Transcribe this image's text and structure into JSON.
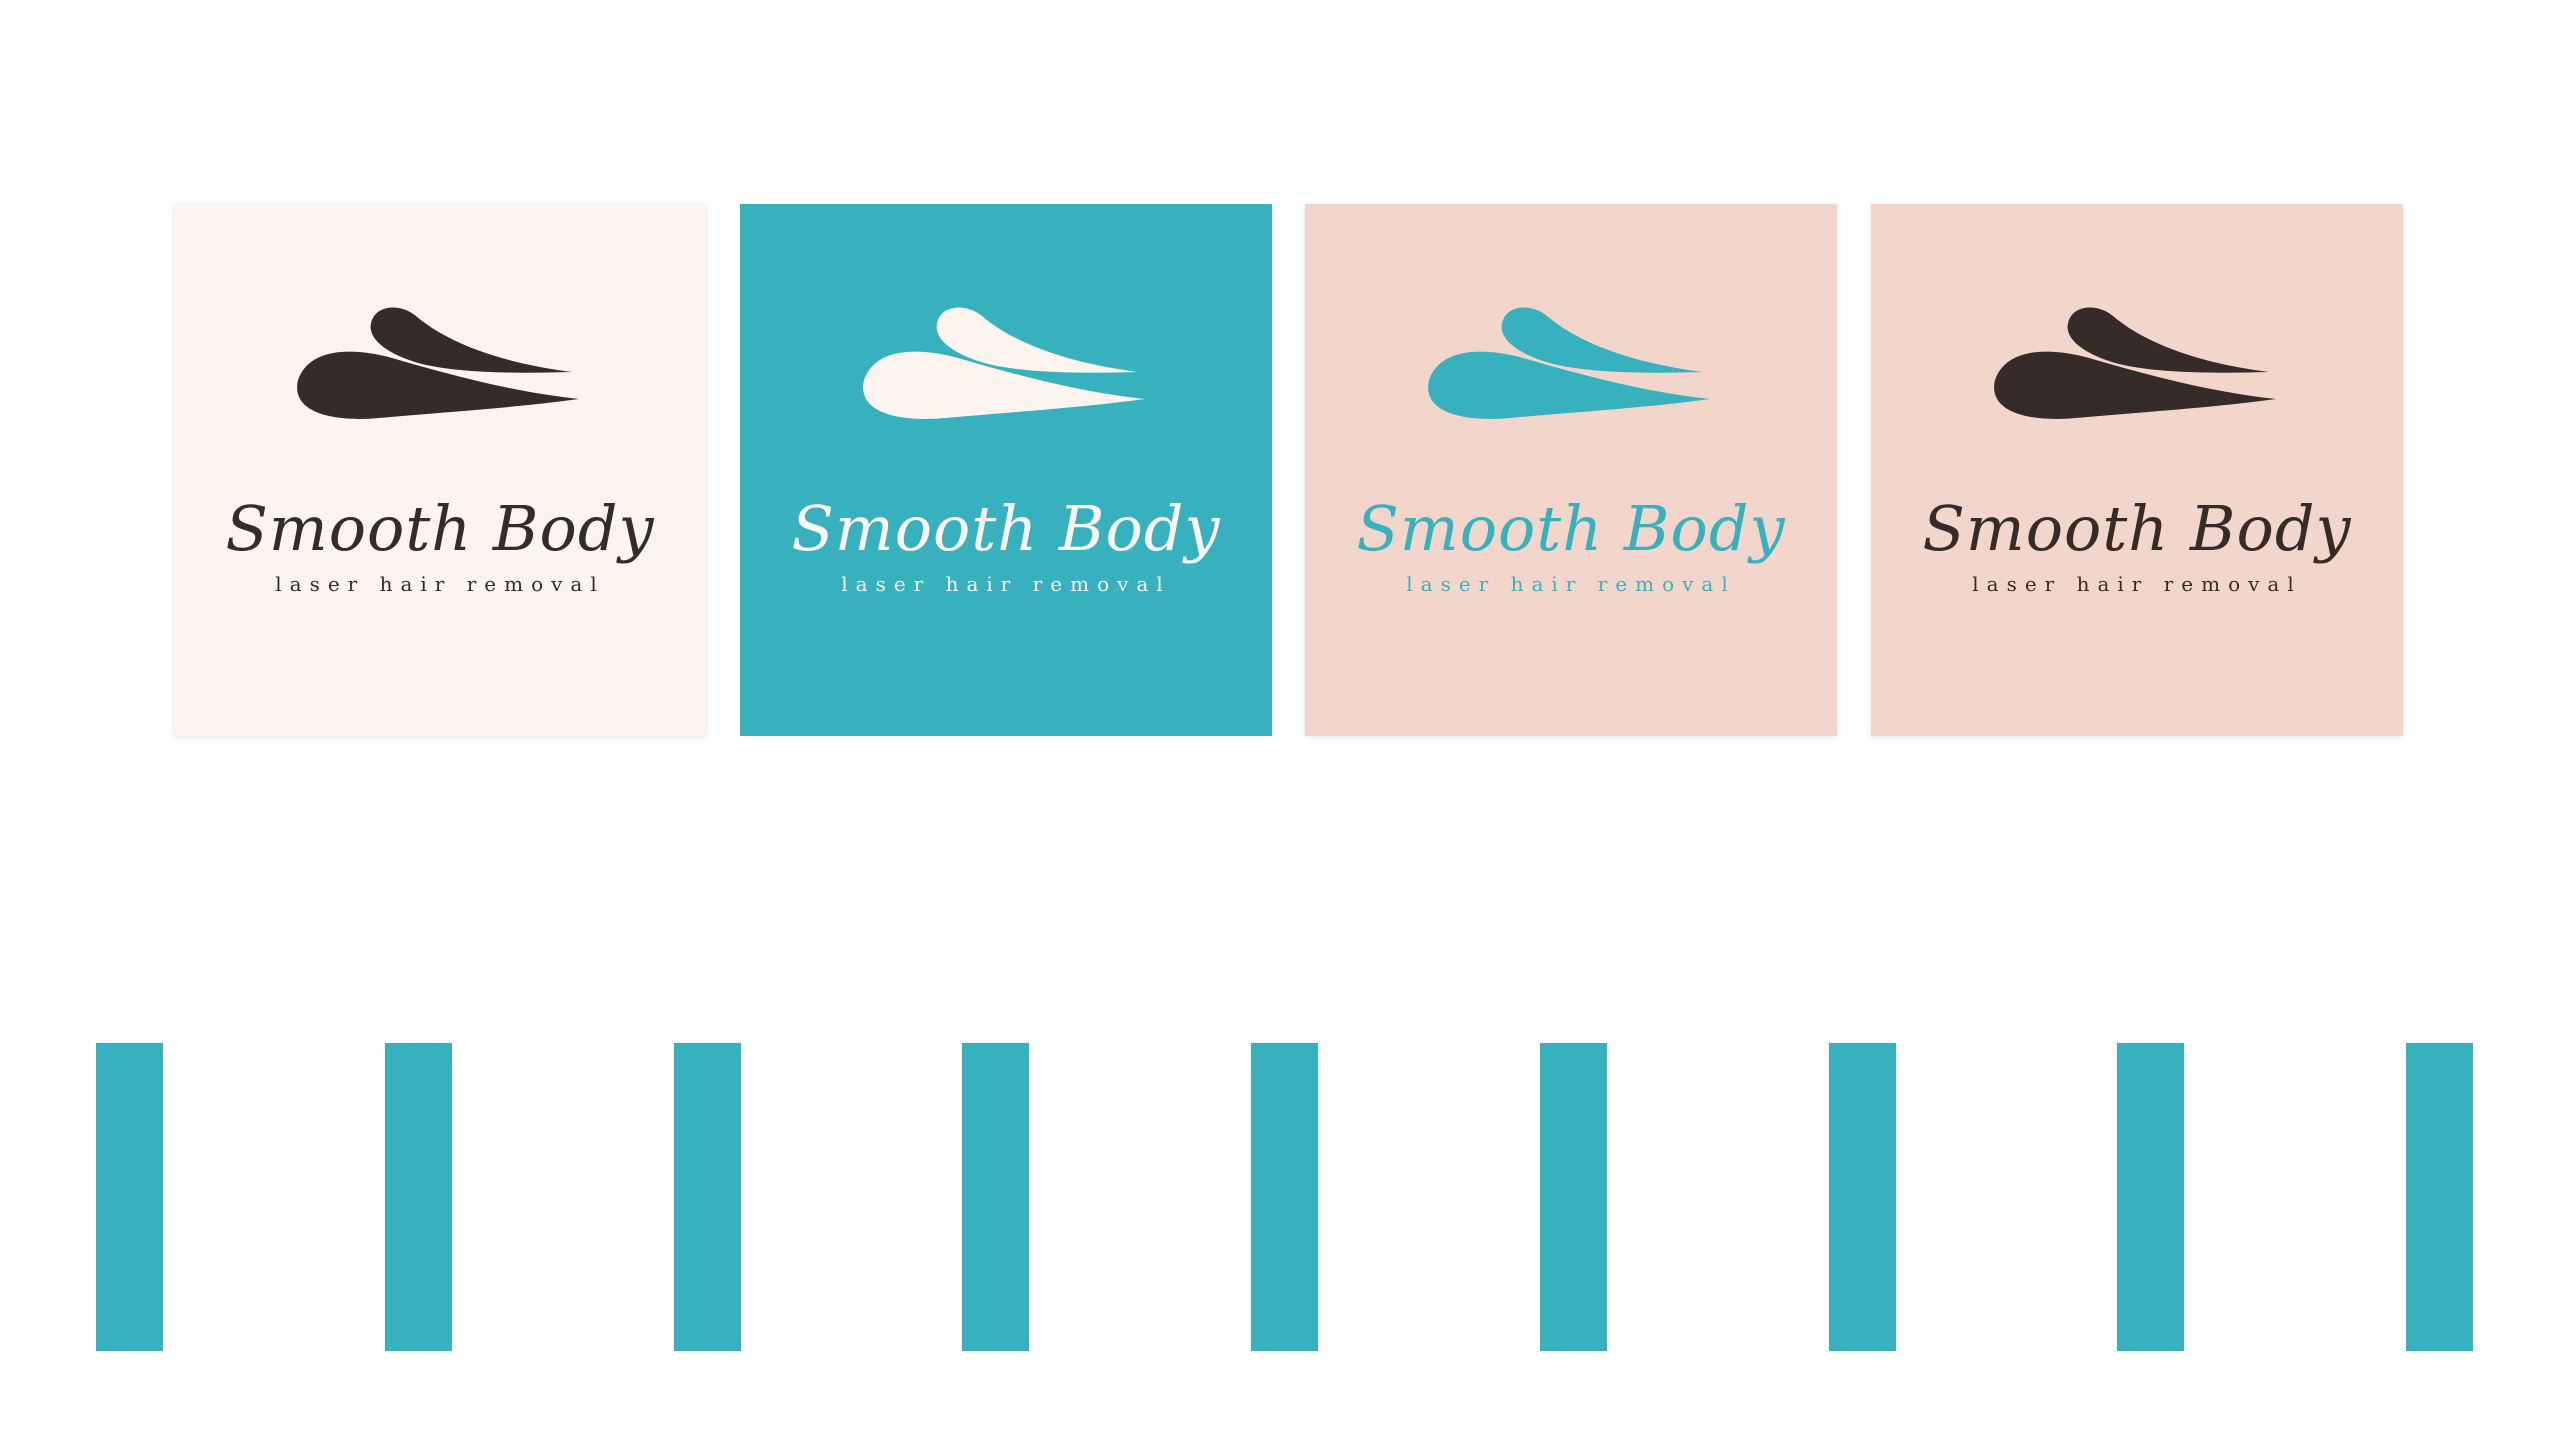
{
  "brand": {
    "name": "Smooth Body",
    "tagline": "laser hair removal"
  },
  "colors": {
    "teal": "#36b1bd",
    "dark": "#352c29",
    "cream": "#fcf4ef",
    "blush": "#f3d6cb",
    "white": "#ffffff"
  },
  "variants": [
    {
      "background": "#fcf4ef",
      "foreground": "#352c29"
    },
    {
      "background": "#36b1bd",
      "foreground": "#fcf4ef"
    },
    {
      "background": "#f3d6cb",
      "foreground": "#36b1bd"
    },
    {
      "background": "#f3d6cb",
      "foreground": "#352c29"
    }
  ],
  "pattern": {
    "type": "vertical-stripes",
    "count": 9,
    "color": "#36b1bd"
  }
}
